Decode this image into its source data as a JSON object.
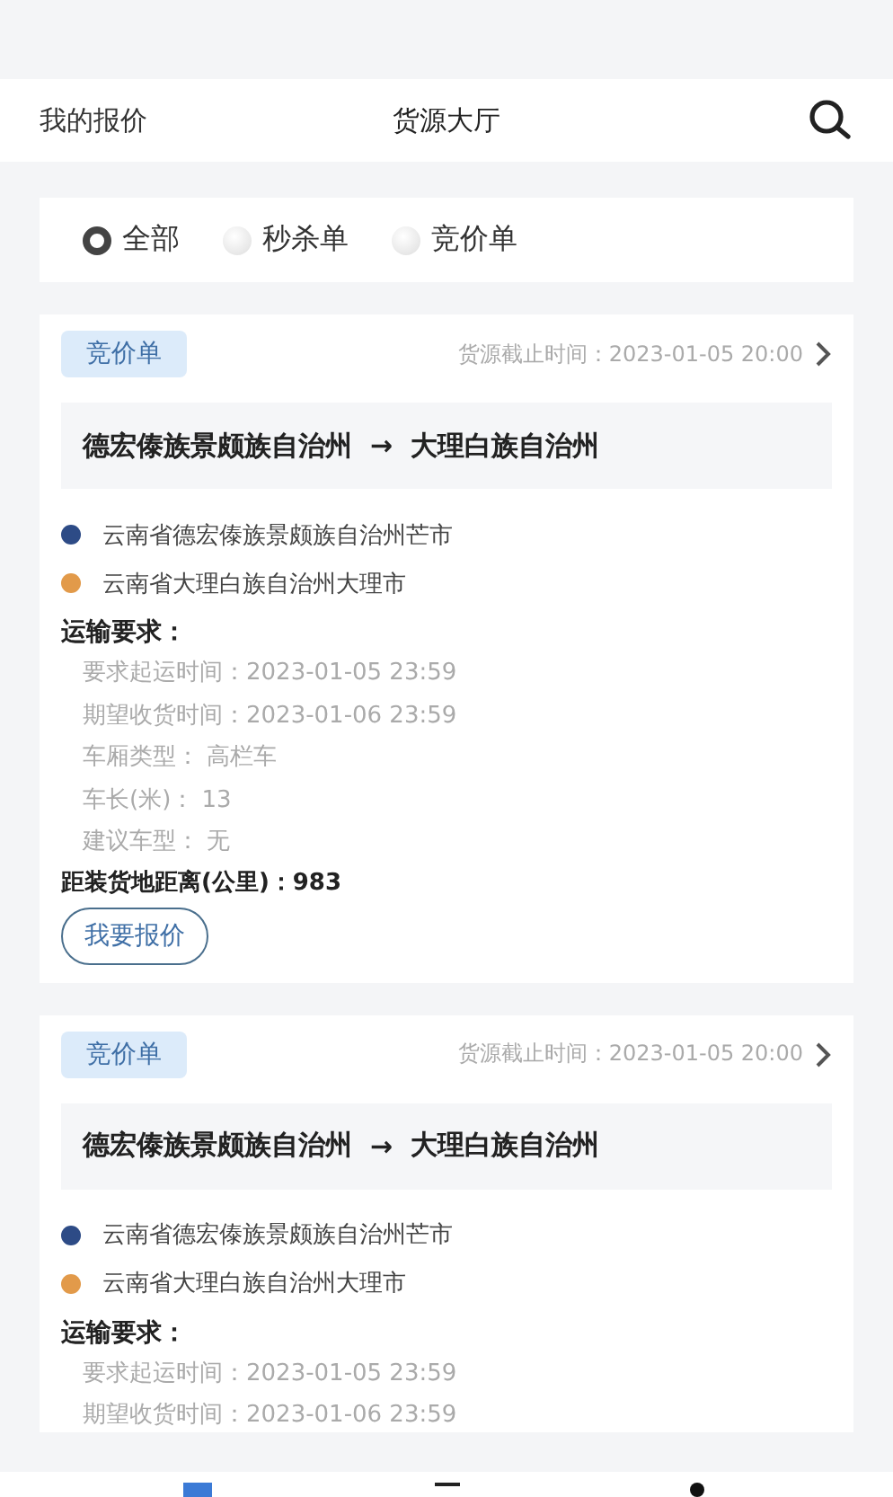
{
  "header": {
    "left_link": "我的报价",
    "title": "货源大厅"
  },
  "filters": [
    {
      "label": "全部",
      "selected": true
    },
    {
      "label": "秒杀单",
      "selected": false
    },
    {
      "label": "竞价单",
      "selected": false
    }
  ],
  "orders": [
    {
      "tag": "竞价单",
      "deadline": "货源截止时间：2023-01-05 20:00",
      "origin": "德宏傣族景颇族自治州",
      "arrow": "→",
      "destination": "大理白族自治州",
      "stops": [
        {
          "address": "云南省德宏傣族景颇族自治州芒市",
          "color": "#2d4b86"
        },
        {
          "address": "云南省大理白族自治州大理市",
          "color": "#e29a4a"
        }
      ],
      "requirements_title": "运输要求：",
      "requirements": [
        "要求起运时间：2023-01-05 23:59",
        "期望收货时间：2023-01-06 23:59",
        "车厢类型： 高栏车",
        "车长(米)： 13",
        "建议车型： 无"
      ],
      "distance": "距装货地距离(公里)：983",
      "quote_button": "我要报价"
    },
    {
      "tag": "竞价单",
      "deadline": "货源截止时间：2023-01-05 20:00",
      "origin": "德宏傣族景颇族自治州",
      "arrow": "→",
      "destination": "大理白族自治州",
      "stops": [
        {
          "address": "云南省德宏傣族景颇族自治州芒市",
          "color": "#2d4b86"
        },
        {
          "address": "云南省大理白族自治州大理市",
          "color": "#e29a4a"
        }
      ],
      "requirements_title": "运输要求：",
      "requirements": [
        "要求起运时间：2023-01-05 23:59",
        "期望收货时间：2023-01-06 23:59"
      ]
    }
  ]
}
